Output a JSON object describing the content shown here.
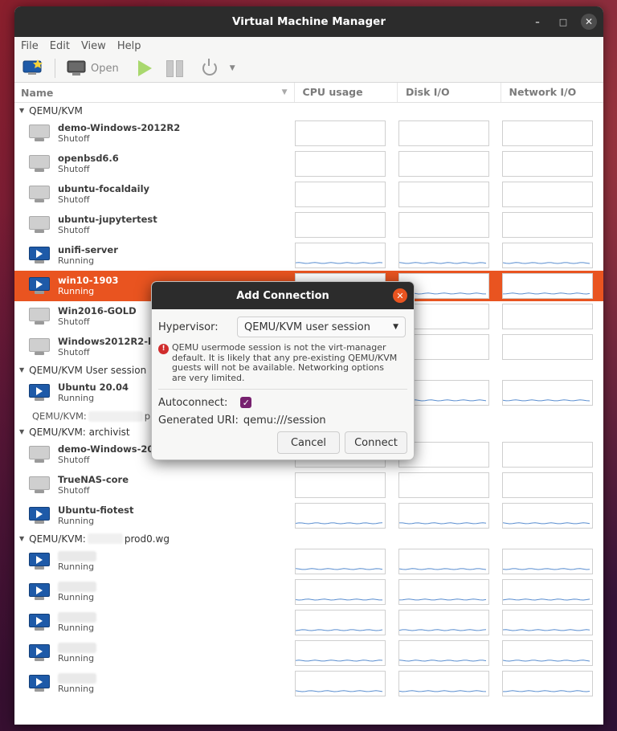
{
  "window": {
    "title": "Virtual Machine Manager"
  },
  "menu": [
    "File",
    "Edit",
    "View",
    "Help"
  ],
  "toolbar": {
    "open_label": "Open"
  },
  "columns": {
    "name": "Name",
    "cpu": "CPU usage",
    "disk": "Disk I/O",
    "network": "Network I/O"
  },
  "groups": [
    {
      "label": "QEMU/KVM"
    },
    {
      "label": "QEMU/KVM User session"
    },
    {
      "label": "QEMU/KVM: archivist"
    },
    {
      "label_pre": "QEMU/KVM:",
      "label_post": "prod0.wg"
    }
  ],
  "vms": [
    {
      "name": "demo-Windows-2012R2",
      "status": "Shutoff"
    },
    {
      "name": "openbsd6.6",
      "status": "Shutoff"
    },
    {
      "name": "ubuntu-focaldaily",
      "status": "Shutoff"
    },
    {
      "name": "ubuntu-jupytertest",
      "status": "Shutoff"
    },
    {
      "name": "unifi-server",
      "status": "Running"
    },
    {
      "name": "win10-1903",
      "status": "Running"
    },
    {
      "name": "Win2016-GOLD",
      "status": "Shutoff"
    },
    {
      "name": "Windows2012R2-lock",
      "status": "Shutoff"
    },
    {
      "name": "Ubuntu 20.04",
      "status": "Running"
    },
    {
      "name": "demo-Windows-2012R2",
      "status": "Shutoff"
    },
    {
      "name": "TrueNAS-core",
      "status": "Shutoff"
    },
    {
      "name": "Ubuntu-fiotest",
      "status": "Running"
    },
    {
      "name": "",
      "status": "Running"
    },
    {
      "name": "",
      "status": "Running"
    },
    {
      "name": "",
      "status": "Running"
    },
    {
      "name": "",
      "status": "Running"
    },
    {
      "name": "",
      "status": "Running"
    }
  ],
  "user_session_conn": {
    "pre": "QEMU/KVM:",
    "post": "pro"
  },
  "dialog": {
    "title": "Add Connection",
    "hypervisor_label": "Hypervisor:",
    "hypervisor_value": "QEMU/KVM user session",
    "warning_lines": [
      "QEMU usermode session is not the virt-manager",
      "default. It is likely that any pre-existing QEMU/KVM",
      "guests will not be available. Networking options",
      "are very limited."
    ],
    "autoconnect_label": "Autoconnect:",
    "autoconnect_checked": true,
    "uri_label": "Generated URI:",
    "uri_value": "qemu:///session",
    "cancel_label": "Cancel",
    "connect_label": "Connect"
  },
  "colors": {
    "accent": "#e95420",
    "titlebar": "#2c2c2c",
    "checkbox": "#77216f",
    "graph_line": "#5a8ed0"
  }
}
